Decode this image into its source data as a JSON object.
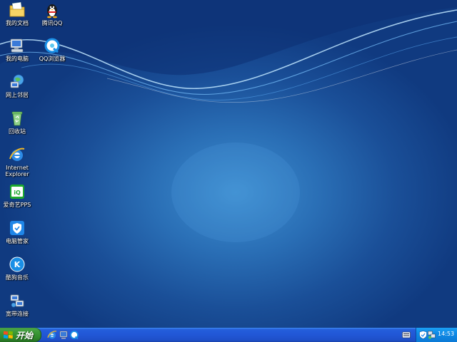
{
  "desktop": {
    "icons": [
      {
        "label": "我的文档",
        "icon": "my-documents-icon"
      },
      {
        "label": "腾讯QQ",
        "icon": "qq-penguin-icon"
      },
      {
        "label": "我的电脑",
        "icon": "my-computer-icon"
      },
      {
        "label": "QQ浏览器",
        "icon": "qq-browser-icon"
      },
      {
        "label": "网上邻居",
        "icon": "network-places-icon"
      },
      {
        "label": "回收站",
        "icon": "recycle-bin-icon"
      },
      {
        "label": "Internet\nExplorer",
        "icon": "internet-explorer-icon"
      },
      {
        "label": "爱奇艺PPS",
        "icon": "iqiyi-icon"
      },
      {
        "label": "电脑管家",
        "icon": "pc-manager-shield-icon"
      },
      {
        "label": "酷狗音乐",
        "icon": "kugou-music-icon"
      },
      {
        "label": "宽带连接",
        "icon": "broadband-connection-icon"
      }
    ]
  },
  "taskbar": {
    "start_label": "开始",
    "quick_launch": [
      "internet-explorer-icon",
      "show-desktop-icon",
      "qq-browser-icon"
    ],
    "tray_icons": [
      "keyboard-icon",
      "security-shield-icon",
      "network-status-icon"
    ],
    "clock": "14:53"
  },
  "colors": {
    "taskbar_blue": "#245edb",
    "start_green": "#3c9a38",
    "tray_blue": "#0f8ae6",
    "wallpaper_blue": "#1a4f98"
  }
}
